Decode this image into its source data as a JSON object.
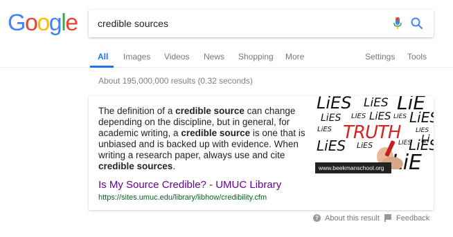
{
  "logo": {
    "letters": [
      "G",
      "o",
      "o",
      "g",
      "l",
      "e"
    ],
    "colors": [
      "#4285F4",
      "#EA4335",
      "#FBBC05",
      "#4285F4",
      "#34A853",
      "#EA4335"
    ]
  },
  "search": {
    "query": "credible sources",
    "mic_icon": "microphone-icon",
    "search_icon": "magnifier-icon"
  },
  "tabs": {
    "items": [
      {
        "label": "All",
        "active": true
      },
      {
        "label": "Images"
      },
      {
        "label": "Videos"
      },
      {
        "label": "News"
      },
      {
        "label": "Shopping"
      },
      {
        "label": "More"
      }
    ],
    "settings": "Settings",
    "tools": "Tools"
  },
  "stats": "About 195,000,000 results (0.32 seconds)",
  "featured": {
    "snippet_parts": [
      {
        "text": "The definition of a "
      },
      {
        "text": "credible source",
        "bold": true
      },
      {
        "text": " can change depending on the discipline, but in general, for academic writing, a "
      },
      {
        "text": "credible source",
        "bold": true
      },
      {
        "text": " is one that is unbiased and is backed up with evidence. When writing a research paper, always use and cite "
      },
      {
        "text": "credible sources",
        "bold": true
      },
      {
        "text": "."
      }
    ],
    "title": "Is My Source Credible? - UMUC Library",
    "url": "https://sites.umuc.edu/library/libhow/credibility.cfm",
    "image_caption": "www.beekmanschool.org"
  },
  "footer": {
    "about": "About this result",
    "feedback": "Feedback"
  },
  "colors": {
    "accent": "#1a73e8",
    "link_visited": "#660099",
    "url_green": "#006621"
  }
}
